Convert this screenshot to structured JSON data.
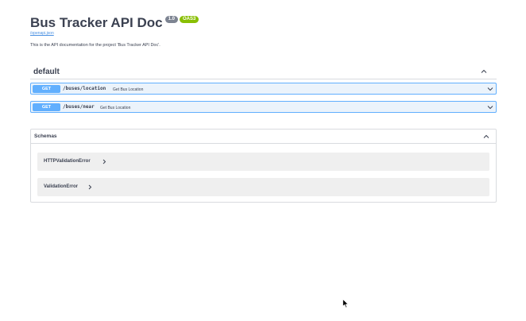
{
  "info": {
    "title": "Bus Tracker API Doc",
    "version": "1.0",
    "oas_badge": "OAS3",
    "spec_link": "/openapi.json",
    "description": "This is the API documentation for the project 'Bus Tracker API Doc'."
  },
  "tag": {
    "name": "default",
    "expanded": true
  },
  "operations": [
    {
      "method": "GET",
      "path": "/buses/location",
      "summary": "Get Bus Location"
    },
    {
      "method": "GET",
      "path": "/buses/near",
      "summary": "Get Bus Location"
    }
  ],
  "schemas": {
    "title": "Schemas",
    "models": [
      {
        "name": "HTTPValidationError"
      },
      {
        "name": "ValidationError"
      }
    ]
  },
  "colors": {
    "get_method": "#61affe",
    "get_background": "#ebf3fb",
    "version_badge": "#7d8492",
    "oas_badge": "#89bf04",
    "link": "#4990e2",
    "text": "#3b4151"
  }
}
